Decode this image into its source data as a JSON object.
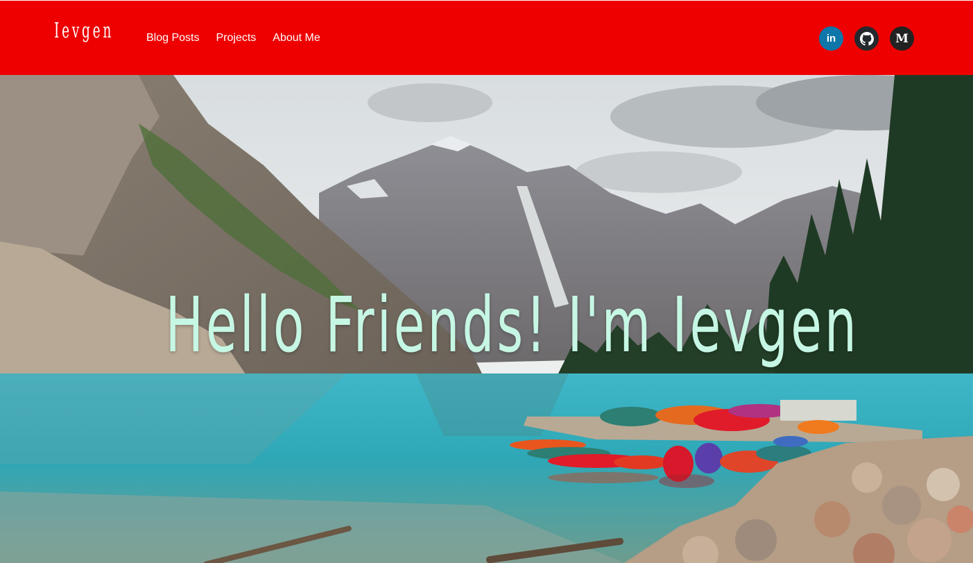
{
  "header": {
    "brand": "Ievgen",
    "nav": [
      {
        "label": "Blog Posts"
      },
      {
        "label": "Projects"
      },
      {
        "label": "About Me"
      }
    ],
    "social": [
      {
        "icon": "linkedin-icon",
        "glyph": "in"
      },
      {
        "icon": "github-icon"
      },
      {
        "icon": "medium-icon",
        "glyph": "M"
      }
    ]
  },
  "hero": {
    "title": "Hello Friends! I'm Ievgen",
    "background": "mountain-lake-with-canoes"
  },
  "colors": {
    "navbar": "#ee0000",
    "title_text": "#c6f7e4",
    "linkedin": "#0e76a8",
    "github": "#24292e"
  }
}
